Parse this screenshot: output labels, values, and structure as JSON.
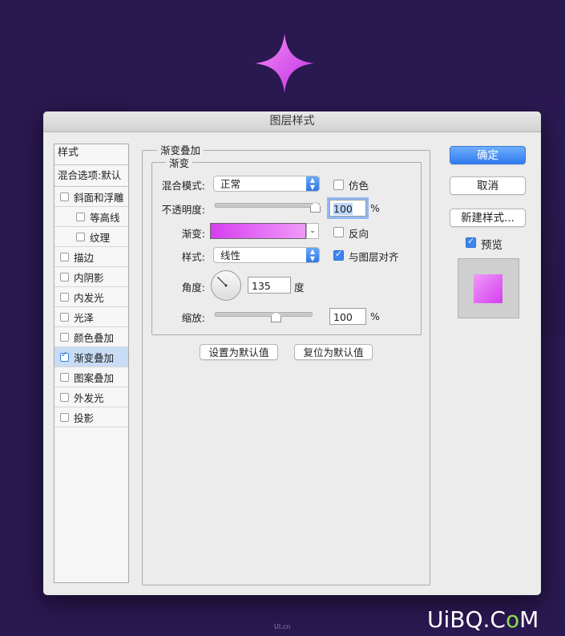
{
  "dialog": {
    "title": "图层样式"
  },
  "style_list": {
    "header": "样式",
    "blend": "混合选项:默认",
    "items": [
      {
        "label": "斜面和浮雕",
        "checked": false,
        "sub": false
      },
      {
        "label": "等高线",
        "checked": false,
        "sub": true
      },
      {
        "label": "纹理",
        "checked": false,
        "sub": true
      },
      {
        "label": "描边",
        "checked": false,
        "sub": false
      },
      {
        "label": "内阴影",
        "checked": false,
        "sub": false
      },
      {
        "label": "内发光",
        "checked": false,
        "sub": false
      },
      {
        "label": "光泽",
        "checked": false,
        "sub": false
      },
      {
        "label": "颜色叠加",
        "checked": false,
        "sub": false
      },
      {
        "label": "渐变叠加",
        "checked": true,
        "sub": false,
        "active": true
      },
      {
        "label": "图案叠加",
        "checked": false,
        "sub": false
      },
      {
        "label": "外发光",
        "checked": false,
        "sub": false
      },
      {
        "label": "投影",
        "checked": false,
        "sub": false
      }
    ]
  },
  "panel": {
    "section_title": "渐变叠加",
    "group_title": "渐变",
    "blend_mode_label": "混合模式:",
    "blend_mode_value": "正常",
    "dither_label": "仿色",
    "opacity_label": "不透明度:",
    "opacity_value": "100",
    "opacity_percent": 1.0,
    "percent": "%",
    "gradient_label": "渐变:",
    "gradient_colors": [
      "#d63ef0",
      "#f09af8"
    ],
    "reverse_label": "反向",
    "style_label": "样式:",
    "style_value": "线性",
    "align_label": "与图层对齐",
    "angle_label": "角度:",
    "angle_value": "135",
    "angle_unit": "度",
    "scale_label": "缩放:",
    "scale_value": "100",
    "set_default": "设置为默认值",
    "reset_default": "复位为默认值"
  },
  "buttons": {
    "ok": "确定",
    "cancel": "取消",
    "new_style": "新建样式...",
    "preview": "预览"
  },
  "colors": {
    "background": "#2a1850",
    "accent": "#2f7af0",
    "star": "#e04ff0"
  },
  "watermark": {
    "text_a": "UiBQ.C",
    "text_o": "o",
    "text_b": "M",
    "small": "UI.cn"
  }
}
